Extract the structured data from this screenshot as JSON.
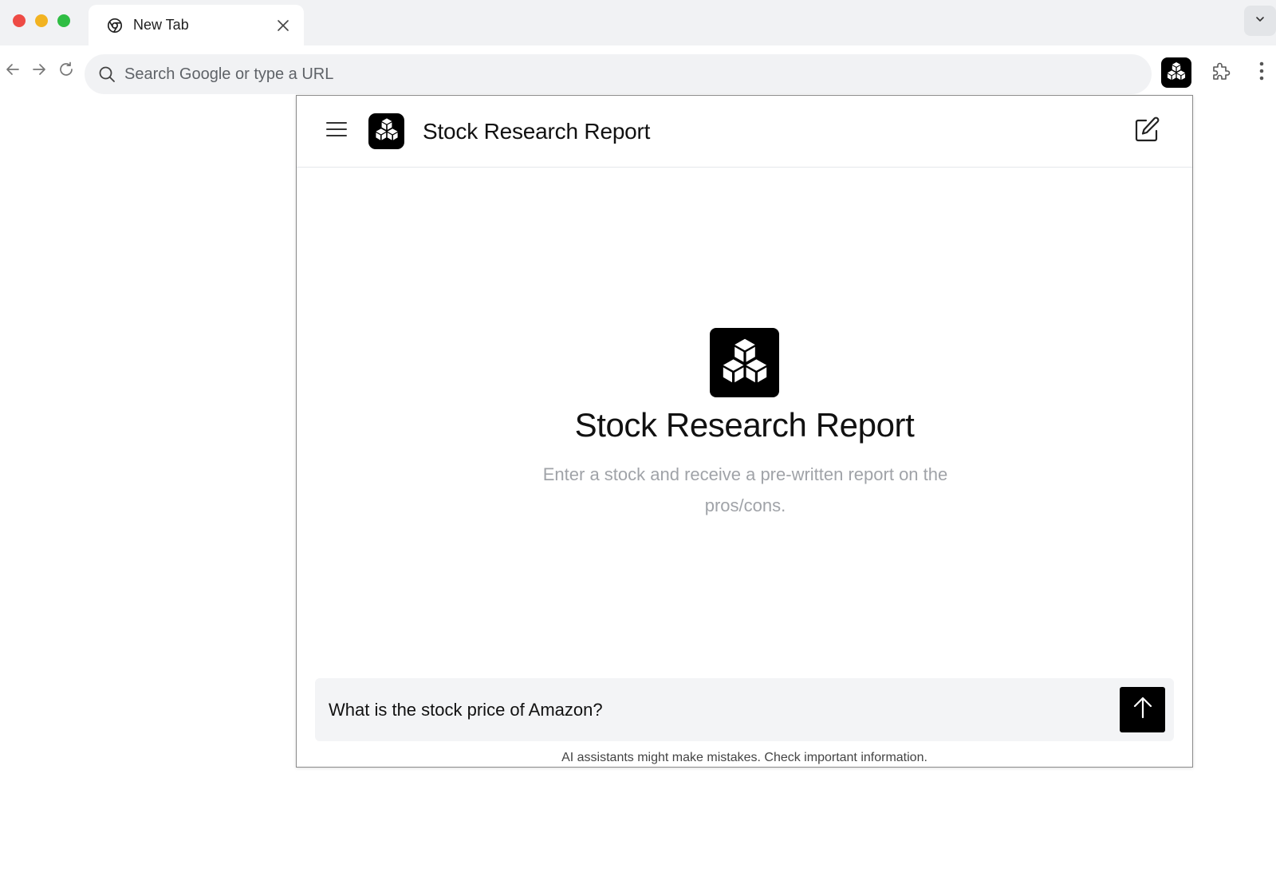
{
  "browser": {
    "tab": {
      "title": "New Tab"
    },
    "omnibox": {
      "placeholder": "Search Google or type a URL"
    }
  },
  "panel": {
    "header": {
      "title": "Stock Research Report"
    },
    "hero": {
      "title": "Stock Research Report",
      "subtitle": "Enter a stock and receive a pre-written report on the pros/cons."
    },
    "composer": {
      "value": "What is the stock price of Amazon?"
    },
    "disclaimer": "AI assistants might make mistakes. Check important information."
  },
  "colors": {
    "tabstrip_bg": "#f1f2f4",
    "accent": "#000000",
    "subtitle": "#a0a3a8",
    "traffic_red": "#ee4b45",
    "traffic_yellow": "#f2b321",
    "traffic_green": "#2fbd43"
  }
}
